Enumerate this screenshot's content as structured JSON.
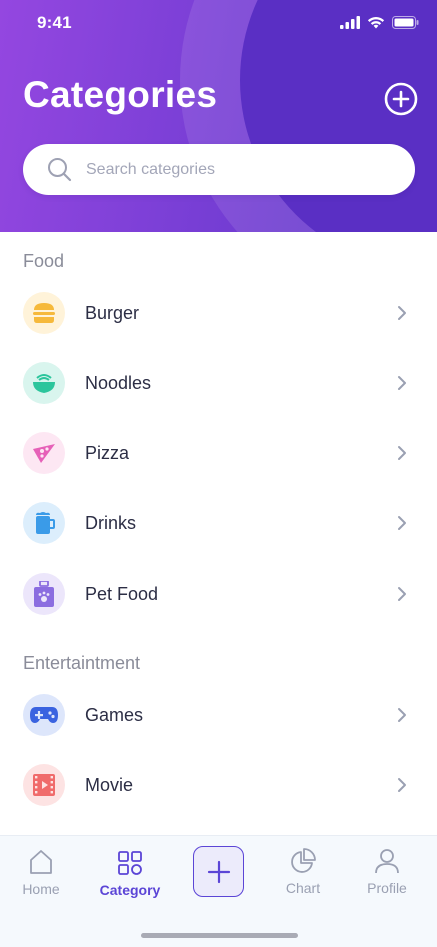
{
  "status_bar": {
    "time": "9:41"
  },
  "header": {
    "title": "Categories"
  },
  "search": {
    "placeholder": "Search categories",
    "value": ""
  },
  "sections": [
    {
      "label": "Food",
      "items": [
        {
          "label": "Burger",
          "icon": "burger-icon",
          "bg": "#fff3d9",
          "color": "#f6b93b"
        },
        {
          "label": "Noodles",
          "icon": "noodles-icon",
          "bg": "#d9f5ee",
          "color": "#2cc59c"
        },
        {
          "label": "Pizza",
          "icon": "pizza-icon",
          "bg": "#fde7f3",
          "color": "#e661b8"
        },
        {
          "label": "Drinks",
          "icon": "drink-icon",
          "bg": "#dceefc",
          "color": "#3a9be8"
        },
        {
          "label": "Pet Food",
          "icon": "pet-food-icon",
          "bg": "#ece6fb",
          "color": "#8b6de0"
        }
      ]
    },
    {
      "label": "Entertaintment",
      "items": [
        {
          "label": "Games",
          "icon": "gamepad-icon",
          "bg": "#dde6fb",
          "color": "#3a63e0"
        },
        {
          "label": "Movie",
          "icon": "film-icon",
          "bg": "#fde3e3",
          "color": "#f06b6b"
        }
      ]
    }
  ],
  "tabbar": {
    "home": "Home",
    "category": "Category",
    "chart": "Chart",
    "profile": "Profile"
  },
  "colors": {
    "accent": "#5b45d6",
    "header_start": "#9447e0",
    "header_end": "#5b35c8"
  }
}
